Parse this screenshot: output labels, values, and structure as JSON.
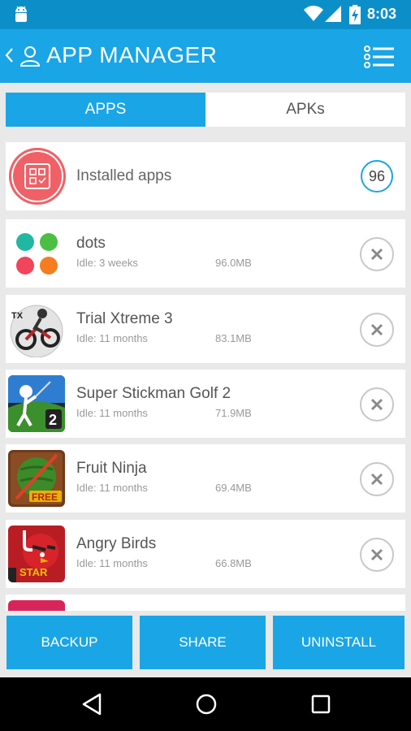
{
  "status_bar": {
    "time": "8:03",
    "icons": [
      "android-debug-icon",
      "wifi-icon",
      "signal-icon",
      "battery-charging-icon"
    ]
  },
  "app_bar": {
    "title": "APP MANAGER",
    "icons": [
      "back-chevron-icon",
      "person-icon",
      "list-menu-icon"
    ]
  },
  "tabs": [
    {
      "label": "APPS",
      "active": true
    },
    {
      "label": "APKs",
      "active": false
    }
  ],
  "installed": {
    "label": "Installed apps",
    "count": "96",
    "icon": "apps-grid-icon"
  },
  "apps": [
    {
      "name": "dots",
      "idle": "Idle: 3 weeks",
      "size": "96.0MB",
      "icon": "dots-app-icon"
    },
    {
      "name": "Trial Xtreme 3",
      "idle": "Idle: 11 months",
      "size": "83.1MB",
      "icon": "trial-xtreme-app-icon"
    },
    {
      "name": "Super Stickman Golf 2",
      "idle": "Idle: 11 months",
      "size": "71.9MB",
      "icon": "stickman-golf-app-icon"
    },
    {
      "name": "Fruit Ninja",
      "idle": "Idle: 11 months",
      "size": "69.4MB",
      "icon": "fruit-ninja-app-icon"
    },
    {
      "name": "Angry Birds",
      "idle": "Idle: 11 months",
      "size": "66.8MB",
      "icon": "angry-birds-app-icon"
    }
  ],
  "actions": {
    "backup": "BACKUP",
    "share": "SHARE",
    "uninstall": "UNINSTALL"
  },
  "colors": {
    "accent": "#1aa5e6",
    "status_bar": "#0c8fc9",
    "installed_icon": "#f06167"
  }
}
